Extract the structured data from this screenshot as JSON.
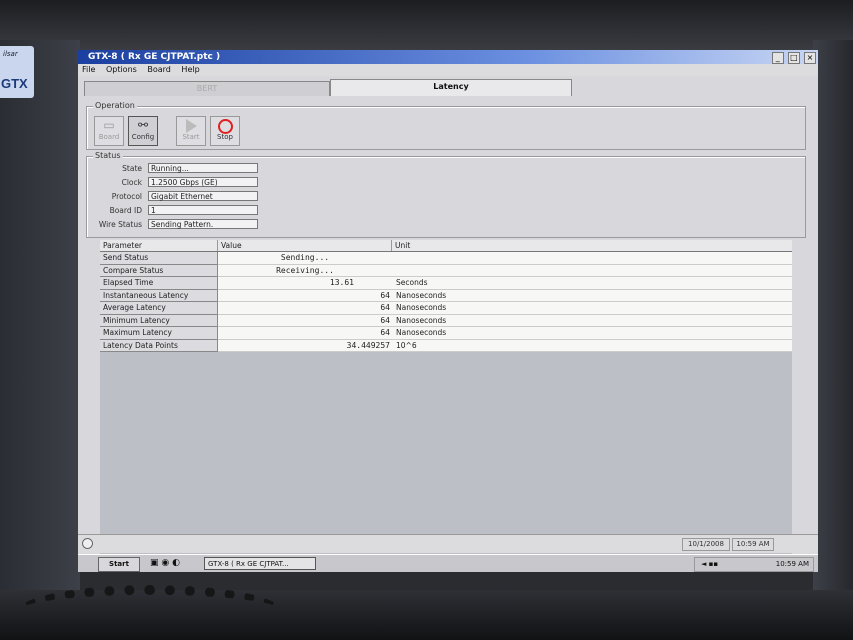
{
  "brand": {
    "small": "ilsar",
    "big": "GTX"
  },
  "window": {
    "title": "GTX-8 ( Rx GE CJTPAT.ptc )",
    "buttons": [
      "_",
      "□",
      "×"
    ]
  },
  "menu": [
    "File",
    "Options",
    "Board",
    "Help"
  ],
  "tabs": [
    {
      "label": "BERT",
      "active": false
    },
    {
      "label": "Latency",
      "active": true
    }
  ],
  "operation": {
    "title": "Operation",
    "buttons": [
      {
        "label": "Board",
        "icon": "board-icon"
      },
      {
        "label": "Config",
        "icon": "config-icon"
      },
      {
        "label": "Start",
        "icon": "play-icon"
      },
      {
        "label": "Stop",
        "icon": "stop-icon"
      }
    ]
  },
  "status": {
    "title": "Status",
    "fields": [
      {
        "label": "State",
        "value": "Running..."
      },
      {
        "label": "Clock",
        "value": "1.2500 Gbps (GE)"
      },
      {
        "label": "Protocol",
        "value": "Gigabit Ethernet"
      },
      {
        "label": "Board ID",
        "value": "1"
      },
      {
        "label": "Wire Status",
        "value": "Sending Pattern."
      }
    ]
  },
  "table": {
    "headers": [
      "Parameter",
      "Value",
      "Unit"
    ],
    "rows": [
      {
        "param": "Send Status",
        "value": "Sending...",
        "unit": ""
      },
      {
        "param": "Compare Status",
        "value": "Receiving...",
        "unit": ""
      },
      {
        "param": "Elapsed Time",
        "value": "13.61",
        "unit": "Seconds"
      },
      {
        "param": "Instantaneous Latency",
        "value": "64",
        "unit": "Nanoseconds"
      },
      {
        "param": "Average Latency",
        "value": "64",
        "unit": "Nanoseconds"
      },
      {
        "param": "Minimum Latency",
        "value": "64",
        "unit": "Nanoseconds"
      },
      {
        "param": "Maximum Latency",
        "value": "64",
        "unit": "Nanoseconds"
      },
      {
        "param": "Latency Data Points",
        "value": "34.449257",
        "unit": "10^6"
      }
    ]
  },
  "statusbar": {
    "date": "10/1/2008",
    "time": "10:59 AM"
  },
  "taskbar": {
    "start": "Start",
    "task": "GTX-8 ( Rx GE CJTPAT...",
    "clock": "10:59 AM"
  }
}
